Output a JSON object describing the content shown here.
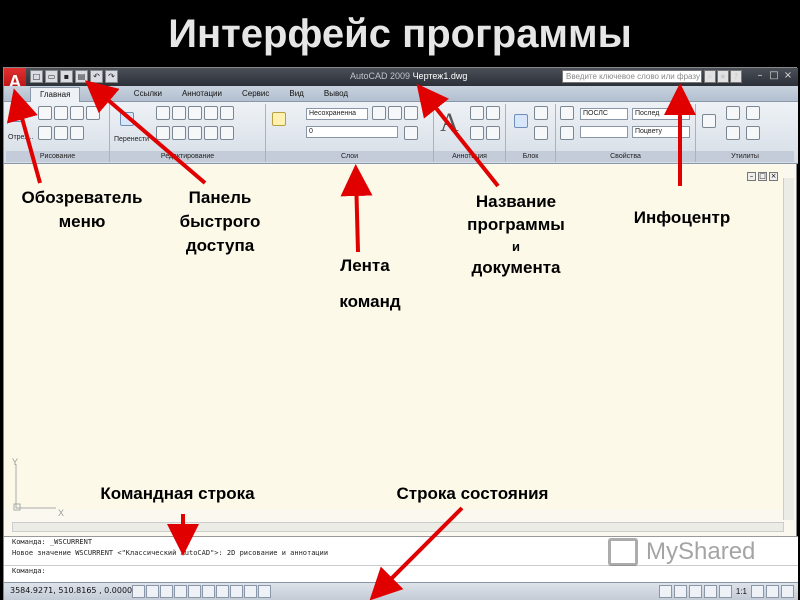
{
  "slide": {
    "title": "Интерфейс программы"
  },
  "titlebar": {
    "app_menu_letter": "A",
    "app_name": "AutoCAD 2009",
    "doc_name": "Чертеж1.dwg",
    "search_placeholder": "Введите ключевое слово или фразу"
  },
  "quick_access": {
    "icons": [
      "new-icon",
      "open-icon",
      "save-icon",
      "print-icon",
      "undo-icon",
      "redo-icon"
    ]
  },
  "tabs": [
    "Главная",
    "Блоки",
    "Ссылки",
    "Аннотации",
    "Сервис",
    "Вид",
    "Вывод"
  ],
  "ribbon": {
    "panels": {
      "draw": "Рисование",
      "modify": "Редактирование",
      "layers": "Слои",
      "annotation": "Аннотация",
      "block": "Блок",
      "properties": "Свойства",
      "utilities": "Утилиты"
    },
    "draw_tool_label": "Отрез...",
    "move_label": "Перенести",
    "layer_state": "Несохраненна",
    "layer_current": "0",
    "color_value": "ПОСЛС",
    "linetype_value": "Послед",
    "lineweight_value": "Поцвету"
  },
  "command_line": {
    "lines": [
      "Команда: _WSCURRENT",
      "Новое значение WSCURRENT <\"Классический AutoCAD\">: 2D рисование и аннотации",
      "Команда:"
    ]
  },
  "status": {
    "coords": "3584.9271, 510.8165 , 0.0000",
    "scale": "1:1"
  },
  "annotations": {
    "menu_browser": "Обозреватель меню",
    "quick_access": "Панель быстрого доступа",
    "ribbon_line1": "Лента",
    "ribbon_line2": "команд",
    "program_name_line1": "Название",
    "program_name_line2": "программы",
    "program_name_and": "и",
    "program_name_line3": "документа",
    "infocenter": "Инфоцентр",
    "command_line": "Командная строка",
    "status_bar": "Строка состояния"
  },
  "ucs": {
    "x": "X",
    "y": "Y"
  },
  "watermark": "MyShared"
}
